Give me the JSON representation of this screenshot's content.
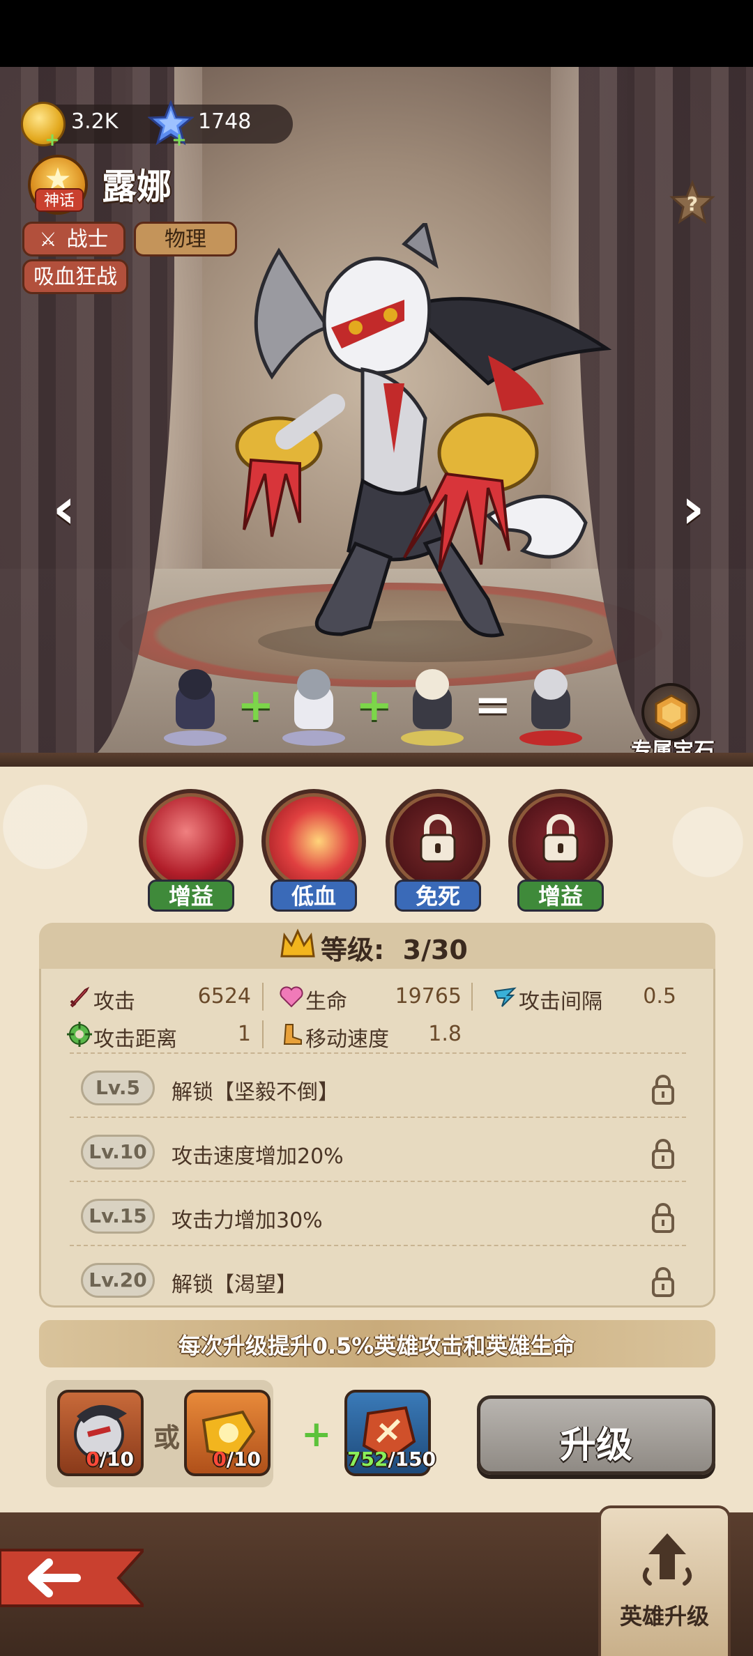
{
  "currency": {
    "gold": "3.2K",
    "gems": "1748"
  },
  "hero": {
    "rank_label": "神话",
    "name": "露娜",
    "class_tag": "战士",
    "damage_tag": "物理",
    "skill_tag": "吸血狂战"
  },
  "fusion": {
    "gem_label": "专属宝石"
  },
  "skills": [
    {
      "label": "增益",
      "locked": false,
      "color": "#3f8a3a"
    },
    {
      "label": "低血",
      "locked": false,
      "color": "#3a6ab8"
    },
    {
      "label": "免死",
      "locked": true,
      "color": "#3a6ab8"
    },
    {
      "label": "增益",
      "locked": true,
      "color": "#3f8a3a"
    }
  ],
  "level": {
    "title": "等级:",
    "value": "3/30"
  },
  "stats": {
    "attack_label": "攻击",
    "attack_value": "6524",
    "hp_label": "生命",
    "hp_value": "19765",
    "interval_label": "攻击间隔",
    "interval_value": "0.5",
    "range_label": "攻击距离",
    "range_value": "1",
    "speed_label": "移动速度",
    "speed_value": "1.8"
  },
  "milestones": [
    {
      "level": "Lv.5",
      "desc": "解锁【坚毅不倒】"
    },
    {
      "level": "Lv.10",
      "desc": "攻击速度增加20%"
    },
    {
      "level": "Lv.15",
      "desc": "攻击力增加30%"
    },
    {
      "level": "Lv.20",
      "desc": "解锁【渴望】"
    }
  ],
  "info_text": "每次升级提升0.5%英雄攻击和英雄生命",
  "materials": {
    "shard_have": "0",
    "shard_need": "/10",
    "token_have": "0",
    "token_need": "/10",
    "or_label": "或",
    "stone_have": "752",
    "stone_need": "/150"
  },
  "upgrade_button": "升级",
  "bottom_nav": {
    "tab_label": "英雄升级"
  },
  "colors": {
    "accent_red": "#b2503c",
    "panel_bg": "#efe2ca",
    "skill_green": "#3f8a3a",
    "skill_blue": "#3a6ab8"
  }
}
